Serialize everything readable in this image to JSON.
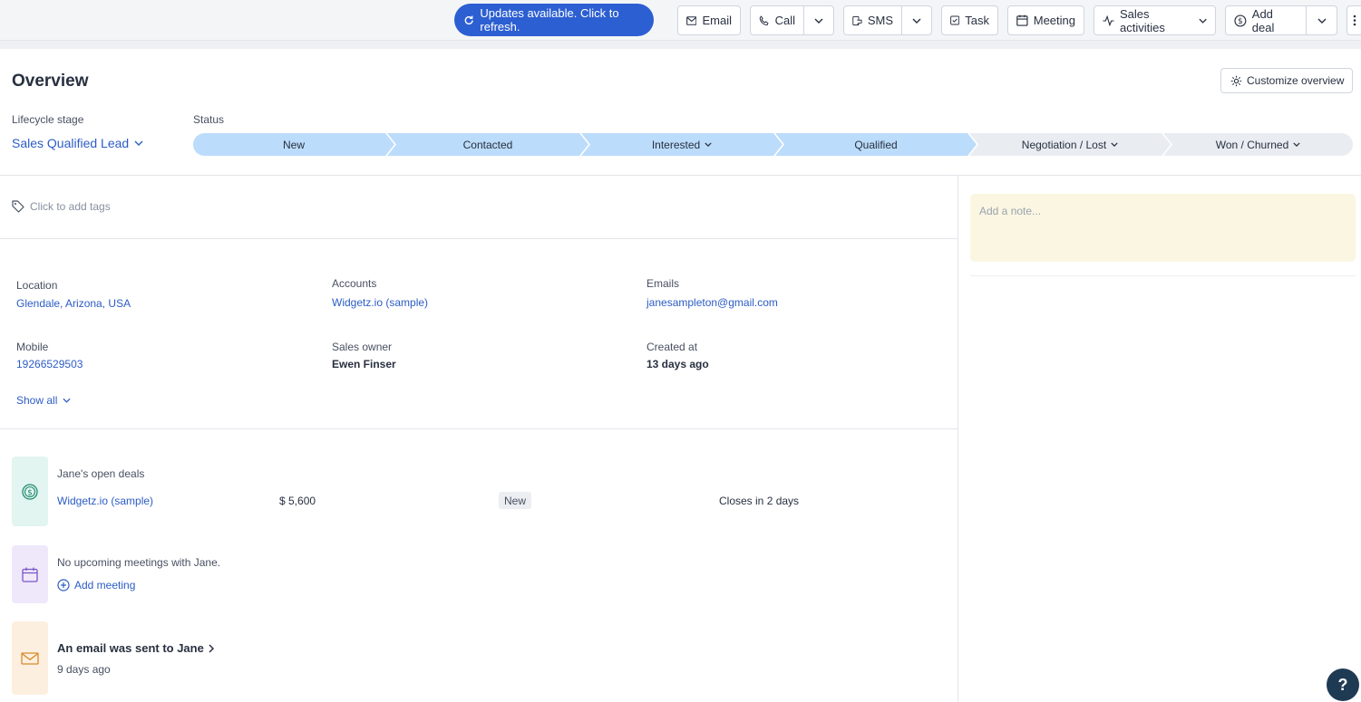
{
  "toolbar": {
    "refresh_banner": "Updates available. Click to refresh.",
    "email": "Email",
    "call": "Call",
    "sms": "SMS",
    "task": "Task",
    "meeting": "Meeting",
    "sales_activities": "Sales activities",
    "add_deal": "Add deal"
  },
  "overview": {
    "title": "Overview",
    "customize_label": "Customize overview",
    "lifecycle_label": "Lifecycle stage",
    "lifecycle_value": "Sales Qualified Lead",
    "status_label": "Status",
    "stages": [
      {
        "label": "New",
        "state": "done"
      },
      {
        "label": "Contacted",
        "state": "done"
      },
      {
        "label": "Interested",
        "state": "done",
        "has_menu": true
      },
      {
        "label": "Qualified",
        "state": "current"
      },
      {
        "label": "Negotiation / Lost",
        "state": "pending",
        "has_menu": true
      },
      {
        "label": "Won / Churned",
        "state": "pending",
        "has_menu": true
      }
    ]
  },
  "tags": {
    "placeholder": "Click to add tags"
  },
  "note": {
    "placeholder": "Add a note..."
  },
  "fields": {
    "location_label": "Location",
    "location_value": "Glendale, Arizona, USA",
    "accounts_label": "Accounts",
    "accounts_value": "Widgetz.io (sample)",
    "emails_label": "Emails",
    "emails_value": "janesampleton@gmail.com",
    "mobile_label": "Mobile",
    "mobile_value": "19266529503",
    "owner_label": "Sales owner",
    "owner_value": "Ewen Finser",
    "created_label": "Created at",
    "created_value": "13 days ago",
    "show_all": "Show all"
  },
  "deals": {
    "heading": "Jane's open deals",
    "name": "Widgetz.io (sample)",
    "amount": "$ 5,600",
    "stage": "New",
    "closes": "Closes in 2 days"
  },
  "meetings": {
    "text": "No upcoming meetings with Jane.",
    "add_label": "Add meeting"
  },
  "email_activity": {
    "title": "An email was sent to Jane",
    "time": "9 days ago"
  },
  "help": {
    "label": "?"
  },
  "colors": {
    "accent": "#2c5fd1",
    "link": "#2c5cc5",
    "stage_done": "#bcdcfb",
    "stage_pending": "#e9ecf1",
    "note_bg": "#faf6e1",
    "deal_tile": "#e2f5f0",
    "meeting_tile": "#efe8fb",
    "email_tile": "#fdefdf"
  }
}
